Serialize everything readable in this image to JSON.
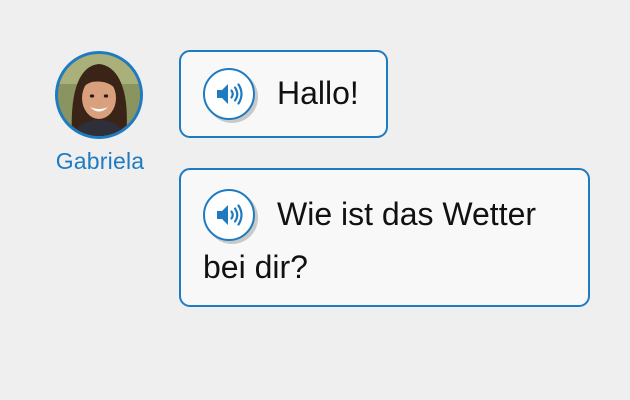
{
  "speaker": {
    "name": "Gabriela"
  },
  "messages": [
    {
      "text": "Hallo!",
      "audio_icon": "speaker-volume-icon"
    },
    {
      "text": "Wie ist das Wetter bei dir?",
      "audio_icon": "speaker-volume-icon"
    }
  ],
  "colors": {
    "accent": "#1f7bc1",
    "background": "#efefef",
    "bubble": "#f8f8f8",
    "text": "#111111"
  }
}
